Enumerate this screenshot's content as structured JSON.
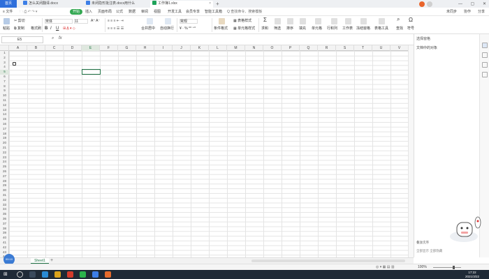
{
  "tabs": {
    "home": "首页",
    "doc1": "怎么关闭翻译.docx",
    "doc2": "未闭隐形批注表.docx用什么",
    "xlsx": "工作簿1.xlsx"
  },
  "menu": {
    "file": "文件",
    "start": "开始",
    "insert": "插入",
    "page_layout": "页面布局",
    "formula": "公式",
    "data": "数据",
    "review": "审阅",
    "view": "视图",
    "dev": "开发工具",
    "member": "会员专享",
    "smart": "智能工具箱",
    "search": "Q 查找命令、搜索模板",
    "unsync": "未同步",
    "collab": "协作",
    "share": "分享"
  },
  "ribbon": {
    "paste": "粘贴",
    "cut": "剪切",
    "copy": "复制",
    "format_painter": "格式刷",
    "font_name": "宋体",
    "font_size": "11",
    "bold": "B",
    "italic": "I",
    "underline": "U",
    "merge_center": "合并居中",
    "wrap": "自动换行",
    "number_format": "常规",
    "cond_format": "条件格式",
    "table_style": "表格样式",
    "cell_style": "单元格样式",
    "sum": "求和",
    "filter": "筛选",
    "sort": "排序",
    "fill": "填充",
    "cell": "单元格",
    "rows_cols": "行和列",
    "worksheet": "工作表",
    "freeze": "冻结窗格",
    "table_tools": "表格工具",
    "find": "查找",
    "symbol": "符号"
  },
  "formula_bar": {
    "cell_ref": "E5",
    "fx": "fx"
  },
  "grid": {
    "columns": [
      "A",
      "B",
      "C",
      "D",
      "E",
      "F",
      "G",
      "H",
      "I",
      "J",
      "K",
      "L",
      "M",
      "N",
      "O",
      "P",
      "Q",
      "R",
      "S",
      "T",
      "U",
      "V"
    ],
    "rows": [
      "1",
      "2",
      "3",
      "4",
      "5",
      "6",
      "7",
      "8",
      "9",
      "10",
      "11",
      "12",
      "13",
      "14",
      "15",
      "16",
      "17",
      "18",
      "19",
      "20",
      "21",
      "22",
      "23",
      "24",
      "25",
      "26",
      "27",
      "28",
      "29",
      "30",
      "31",
      "32",
      "33",
      "34",
      "35",
      "36",
      "37",
      "38",
      "39",
      "40",
      "41",
      "42",
      "43",
      "44"
    ],
    "selected_cell": "E5"
  },
  "sheets": {
    "active": "Sheet1",
    "add": "+",
    "nav_label": "00:10"
  },
  "panel": {
    "title": "选择窗格",
    "subtitle": "文档中的对象",
    "footer": "叠放次序",
    "footer2": "全部显示    全部隐藏"
  },
  "status": {
    "zoom": "100%"
  },
  "taskbar": {
    "time": "17:22",
    "date": "2021/3/22"
  },
  "colors": {
    "accent": "#217346",
    "start_tab": "#34a853",
    "home_tab": "#2f6fdb",
    "taskbar": "#1f2a36"
  }
}
